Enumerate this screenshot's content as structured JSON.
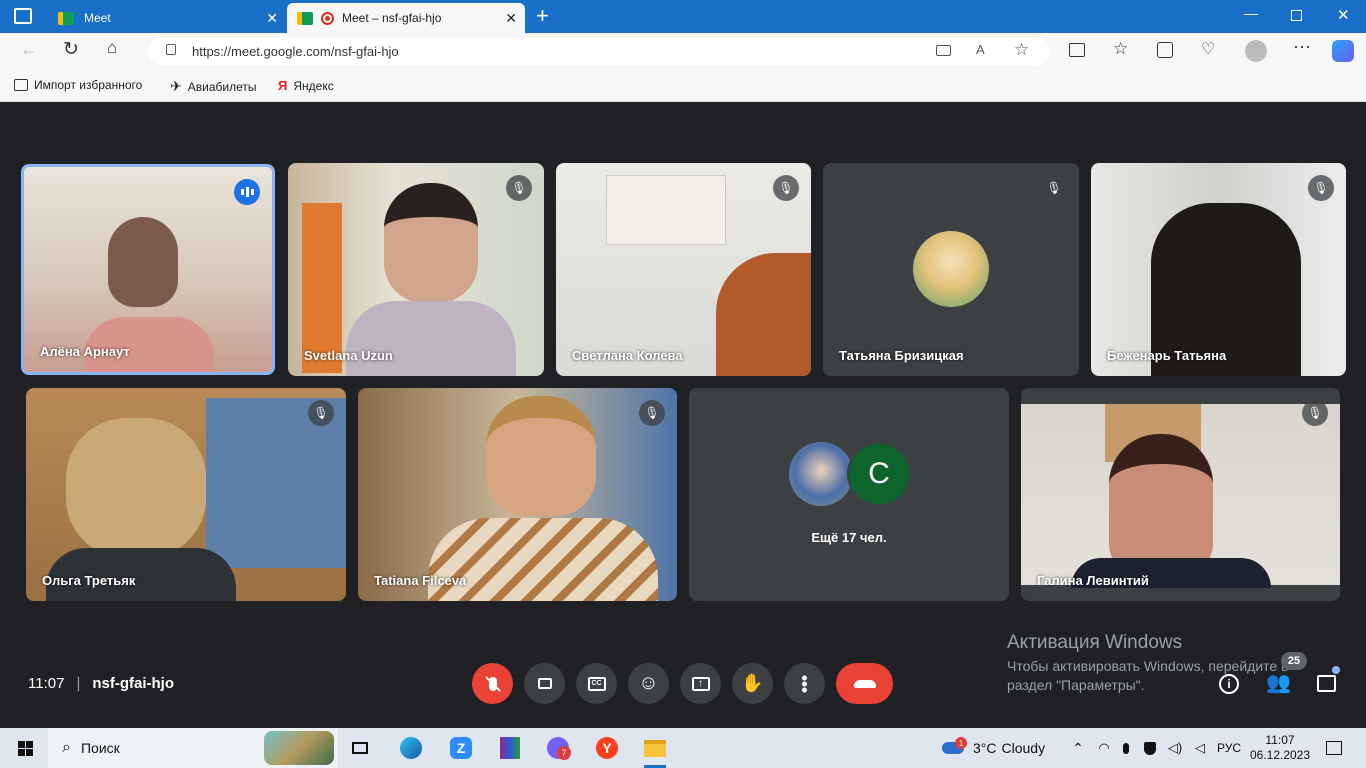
{
  "browser": {
    "tabs": [
      {
        "title": "Meet",
        "active": false
      },
      {
        "title": "Meet – nsf-gfai-hjo",
        "active": true
      }
    ],
    "url": "https://meet.google.com/nsf-gfai-hjo",
    "bookmarks": [
      "Импорт избранного",
      "Авиабилеты",
      "Яндекс"
    ]
  },
  "meet": {
    "participants_row1": [
      {
        "name": "Алёна Арнаут",
        "speaking": true
      },
      {
        "name": "Svetlana Uzun",
        "muted": true
      },
      {
        "name": "Светлана Колева",
        "muted": true
      },
      {
        "name": "Татьяна Бризицкая",
        "muted": true
      },
      {
        "name": "Беженарь Татьяна",
        "muted": true
      }
    ],
    "participants_row2": [
      {
        "name": "Ольга Третьяк",
        "muted": true
      },
      {
        "name": "Tatiana Filceva",
        "muted": true
      },
      {
        "name": "Галина Левинтий",
        "muted": true
      }
    ],
    "more_tile": {
      "avatar_letter": "C",
      "label": "Ещё 17 чел."
    },
    "time": "11:07",
    "meeting_code": "nsf-gfai-hjo",
    "participant_count": "25",
    "activation": {
      "title": "Активация Windows",
      "line1": "Чтобы активировать Windows, перейдите в",
      "line2": "раздел \"Параметры\"."
    }
  },
  "taskbar": {
    "search_label": "Поиск",
    "weather_temp": "3°C",
    "weather_text": "Cloudy",
    "lang": "РУС",
    "clock_time": "11:07",
    "clock_date": "06.12.2023",
    "viber_badge": "7",
    "weather_badge": "1"
  },
  "colors": {
    "accent_blue": "#1a6fc8",
    "end_call_red": "#ea4335",
    "meet_bg": "#202124"
  }
}
